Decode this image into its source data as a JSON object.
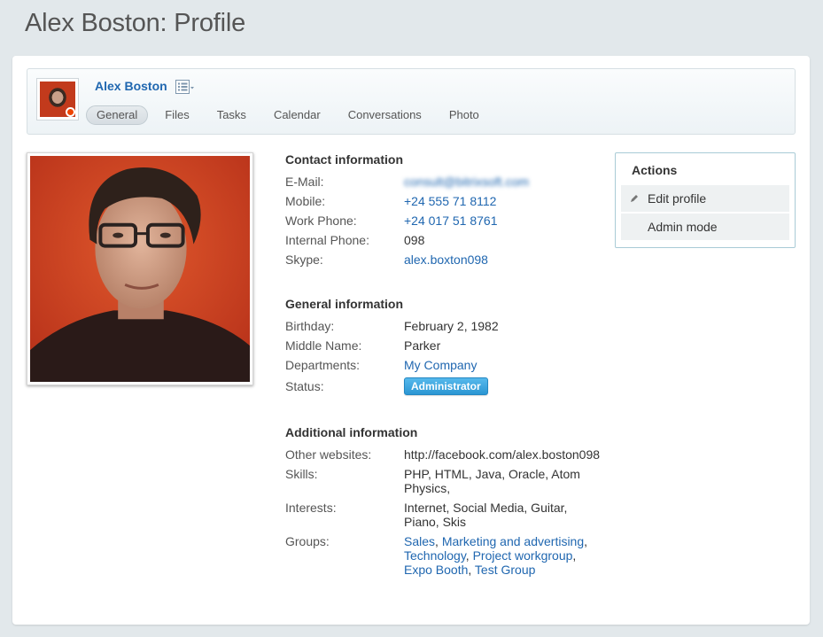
{
  "page": {
    "title": "Alex Boston: Profile"
  },
  "user_bar": {
    "name": "Alex Boston",
    "tabs": [
      {
        "label": "General",
        "active": true
      },
      {
        "label": "Files",
        "active": false
      },
      {
        "label": "Tasks",
        "active": false
      },
      {
        "label": "Calendar",
        "active": false
      },
      {
        "label": "Conversations",
        "active": false
      },
      {
        "label": "Photo",
        "active": false
      }
    ],
    "status_color": "#ee4400"
  },
  "contact": {
    "title": "Contact information",
    "rows": [
      {
        "label": "E-Mail:",
        "value": "consult@bitrixsoft.com"
      },
      {
        "label": "Mobile:",
        "value": "+24 555 71 8112"
      },
      {
        "label": "Work Phone:",
        "value": "+24 017 51 8761"
      },
      {
        "label": "Internal Phone:",
        "value": "098"
      },
      {
        "label": "Skype:",
        "value": "alex.boxton098"
      }
    ]
  },
  "general": {
    "title": "General information",
    "birthday_label": "Birthday:",
    "birthday": "February 2, 1982",
    "middle_label": "Middle Name:",
    "middle": "Parker",
    "departments_label": "Departments:",
    "departments": "My Company",
    "status_label": "Status:",
    "status": "Administrator"
  },
  "additional": {
    "title": "Additional information",
    "websites_label": "Other websites:",
    "websites": "http://facebook.com/alex.boston098",
    "skills_label": "Skills:",
    "skills": "PHP, HTML, Java, Oracle, Atom Physics,",
    "interests_label": "Interests:",
    "interests": "Internet, Social Media, Guitar, Piano, Skis",
    "groups_label": "Groups:",
    "groups": [
      "Sales",
      "Marketing and advertising",
      "Technology",
      "Project workgroup",
      "Expo Booth",
      "Test Group"
    ]
  },
  "actions": {
    "title": "Actions",
    "edit_profile": "Edit profile",
    "admin_mode": "Admin mode"
  },
  "colors": {
    "link": "#2067b0",
    "badge": "#2b96d3",
    "background": "#e2e8eb"
  }
}
